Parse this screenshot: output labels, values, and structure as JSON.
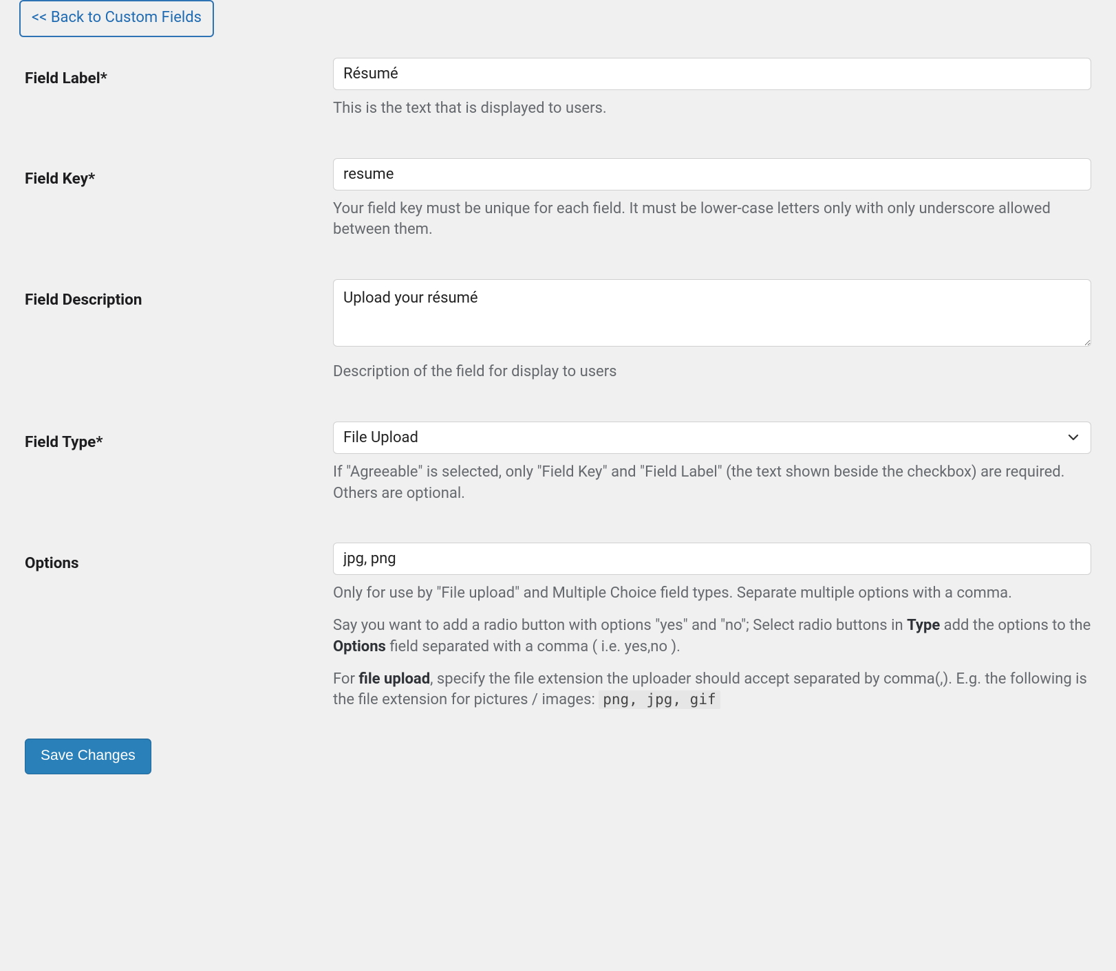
{
  "back_button": {
    "label": "<< Back to Custom Fields"
  },
  "fields": {
    "label": {
      "title": "Field Label*",
      "value": "Résumé",
      "help": "This is the text that is displayed to users."
    },
    "key": {
      "title": "Field Key*",
      "value": "resume",
      "help": "Your field key must be unique for each field. It must be lower-case letters only with only underscore allowed between them."
    },
    "desc": {
      "title": "Field Description",
      "value": "Upload your résumé",
      "help": "Description of the field for display to users"
    },
    "type": {
      "title": "Field Type*",
      "value": "File Upload",
      "help": "If \"Agreeable\" is selected, only \"Field Key\" and \"Field Label\" (the text shown beside the checkbox) are required. Others are optional."
    },
    "options": {
      "title": "Options",
      "value": "jpg, png",
      "help1": "Only for use by \"File upload\" and Multiple Choice field types. Separate multiple options with a comma.",
      "help2_pre": "Say you want to add a radio button with options \"yes\" and \"no\"; Select radio buttons in ",
      "help2_type": "Type",
      "help2_mid": " add the options to the ",
      "help2_options": "Options",
      "help2_post": " field separated with a comma ( i.e. yes,no ).",
      "help3_pre": "For ",
      "help3_bold": "file upload",
      "help3_post": ", specify the file extension the uploader should accept separated by comma(,). E.g. the following is the file extension for pictures / images: ",
      "help3_code": "png, jpg, gif"
    }
  },
  "save_button": {
    "label": "Save Changes"
  }
}
